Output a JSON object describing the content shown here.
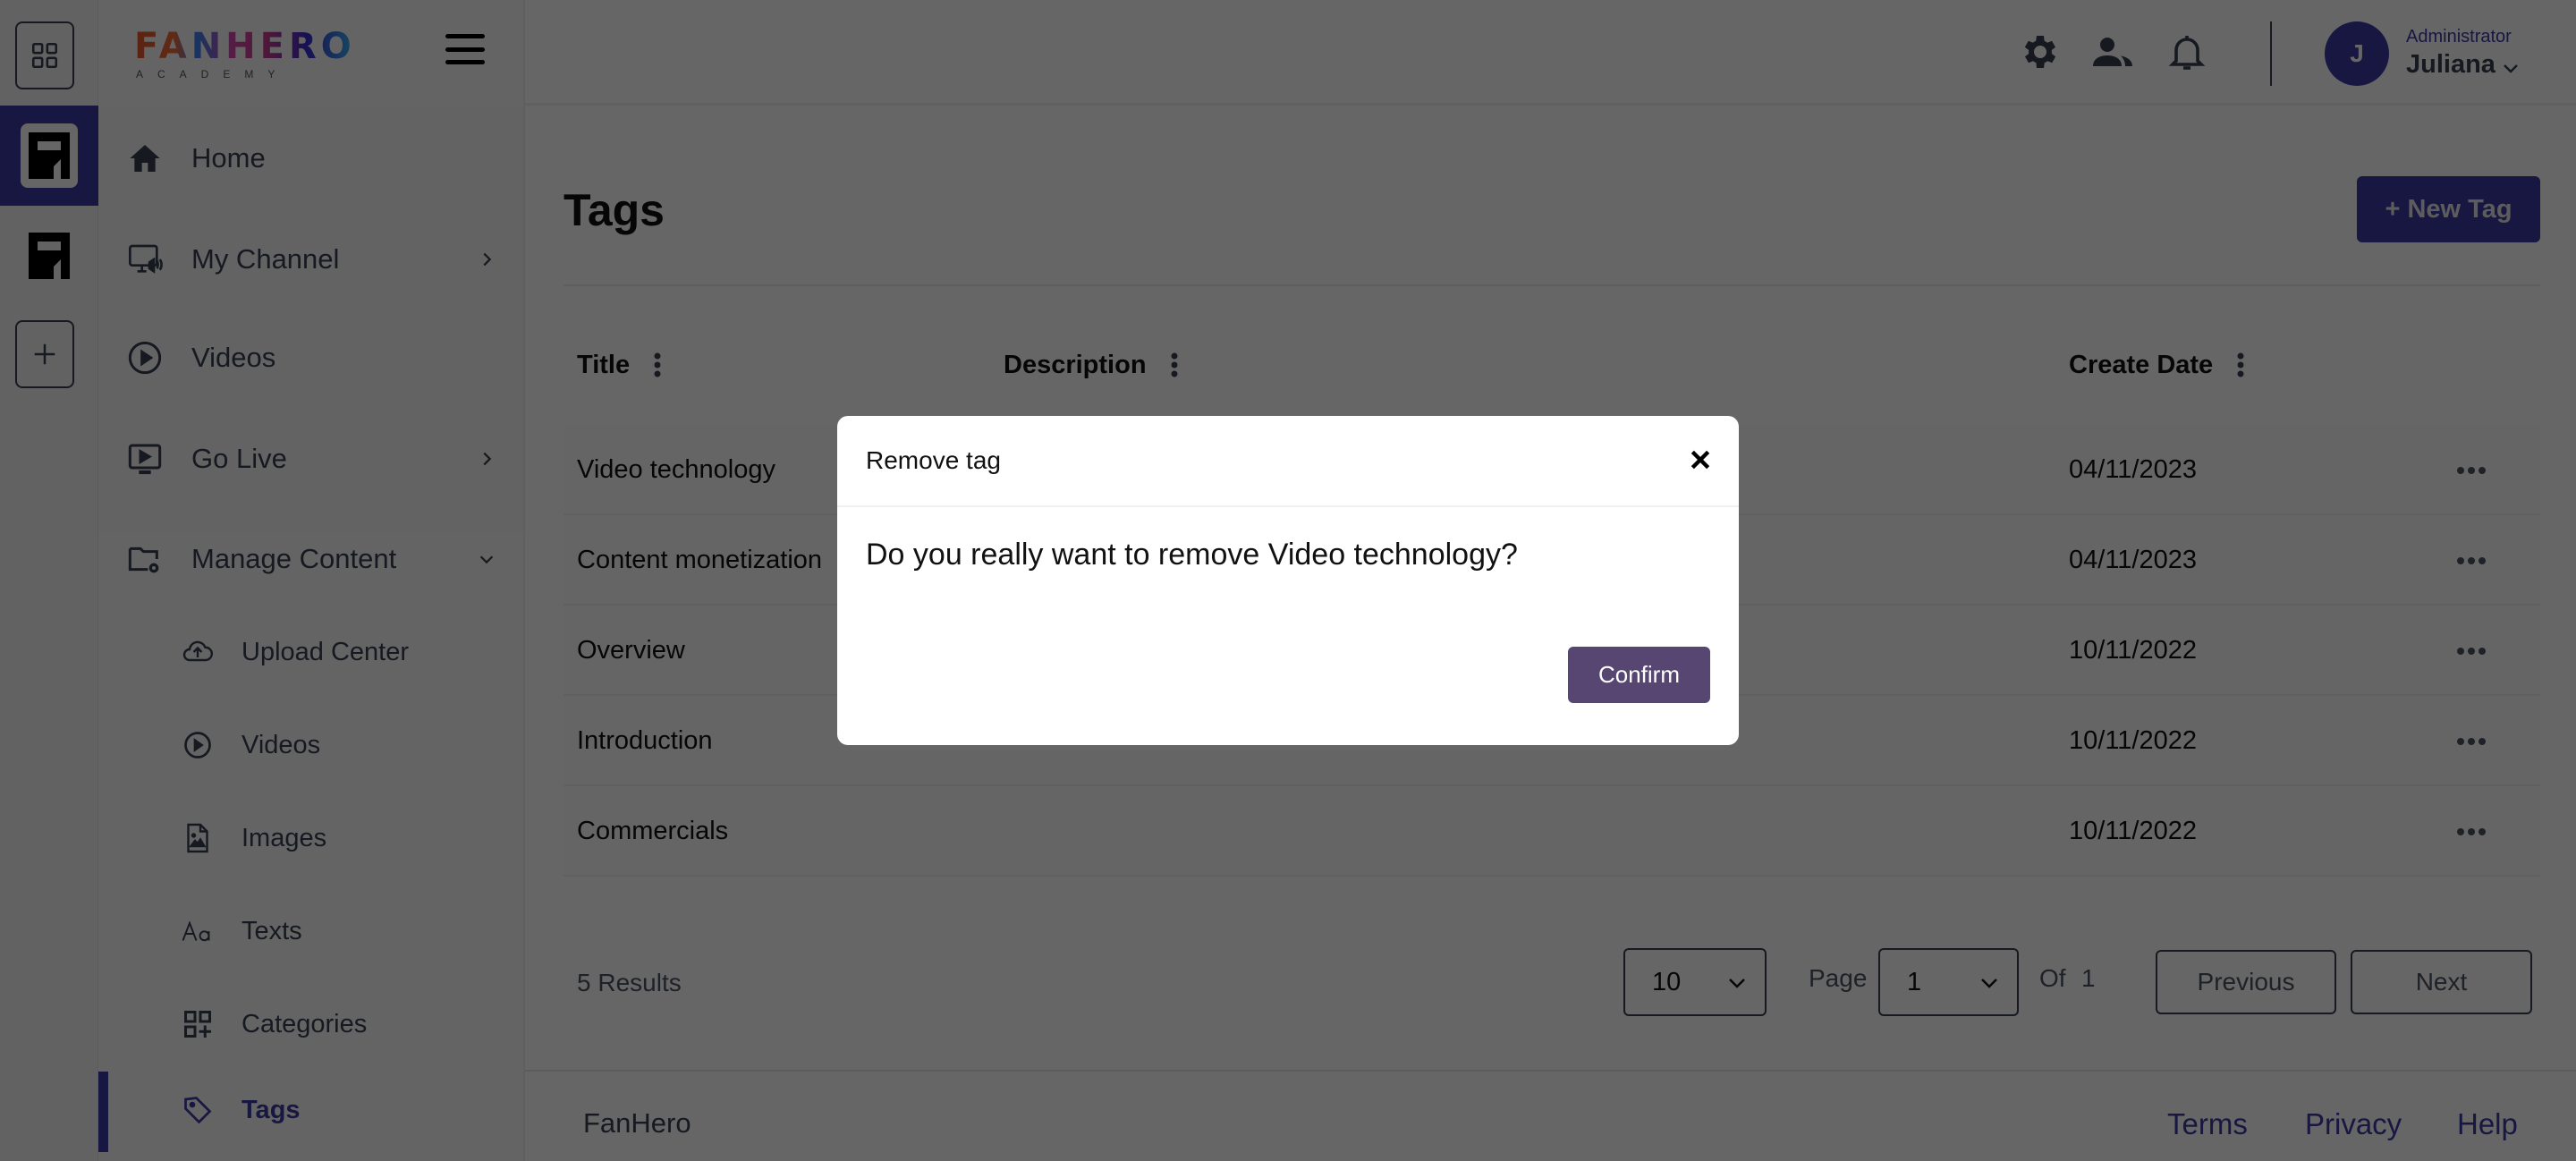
{
  "rail": {
    "apps_button": "apps-grid",
    "workspaces": [
      {
        "label": "FH",
        "active": true
      },
      {
        "label": "FH",
        "active": false
      }
    ],
    "add_button": "+"
  },
  "brand": {
    "name": "FANHERO",
    "subtitle": "ACADEMY"
  },
  "sidebar": {
    "items": [
      {
        "label": "Home",
        "icon": "home-icon",
        "chevron": "none"
      },
      {
        "label": "My Channel",
        "icon": "monitor-speaker-icon",
        "chevron": "right"
      },
      {
        "label": "Videos",
        "icon": "play-circle-icon",
        "chevron": "none"
      },
      {
        "label": "Go Live",
        "icon": "live-screen-icon",
        "chevron": "right"
      },
      {
        "label": "Manage Content",
        "icon": "folder-gear-icon",
        "chevron": "down"
      }
    ],
    "sub_items": [
      {
        "label": "Upload Center",
        "icon": "cloud-upload-icon",
        "active": false
      },
      {
        "label": "Videos",
        "icon": "play-circle-icon",
        "active": false
      },
      {
        "label": "Images",
        "icon": "image-file-icon",
        "active": false
      },
      {
        "label": "Texts",
        "icon": "text-aa-icon",
        "active": false
      },
      {
        "label": "Categories",
        "icon": "category-grid-icon",
        "active": false
      },
      {
        "label": "Tags",
        "icon": "tag-icon",
        "active": true
      }
    ]
  },
  "header": {
    "icons": [
      "gear-icon",
      "users-icon",
      "bell-icon"
    ],
    "user": {
      "initial": "J",
      "role": "Administrator",
      "name": "Juliana"
    }
  },
  "page": {
    "title": "Tags",
    "new_button": "+ New Tag"
  },
  "table": {
    "columns": [
      "Title",
      "Description",
      "Create Date"
    ],
    "rows": [
      {
        "title": "Video technology",
        "description": "",
        "create_date": "04/11/2023"
      },
      {
        "title": "Content monetization",
        "description": "",
        "create_date": "04/11/2023"
      },
      {
        "title": "Overview",
        "description": "",
        "create_date": "10/11/2022"
      },
      {
        "title": "Introduction",
        "description": "",
        "create_date": "10/11/2022"
      },
      {
        "title": "Commercials",
        "description": "",
        "create_date": "10/11/2022"
      }
    ]
  },
  "pagination": {
    "results": "5 Results",
    "per_page": "10",
    "page_label": "Page",
    "page": "1",
    "of_label": "Of",
    "total_pages": "1",
    "previous": "Previous",
    "next": "Next"
  },
  "footer": {
    "brand": "FanHero",
    "links": [
      "Terms",
      "Privacy",
      "Help"
    ]
  },
  "modal": {
    "title": "Remove tag",
    "message": "Do you really want to remove Video technology?",
    "confirm": "Confirm"
  },
  "colors": {
    "primary": "#3b3aa6",
    "confirm": "#574672",
    "overlay": "rgba(0,0,0,0.6)"
  }
}
